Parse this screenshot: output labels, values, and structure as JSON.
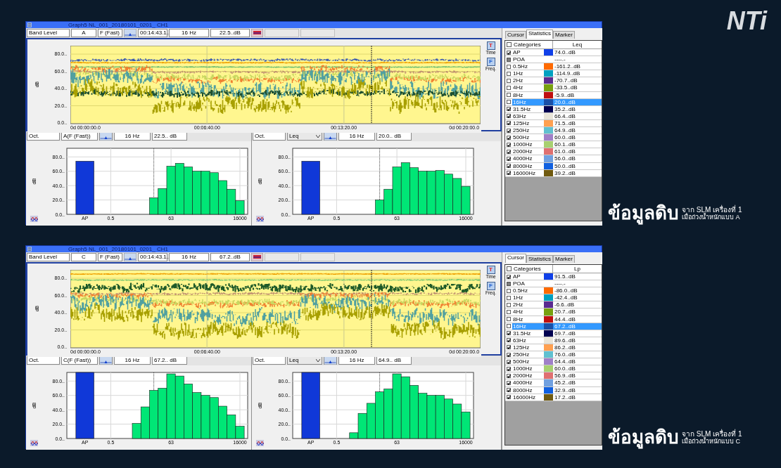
{
  "logo": "NTi",
  "panels": [
    {
      "title": "Graph5 NL_001_20180101_0201_ CH1",
      "toolbar": {
        "band_mode": "Band Level",
        "weighting": "A",
        "time_weighting": "F (Fast)",
        "time": "00:14:43.1..",
        "frequency": "16 Hz",
        "level": "22.5..dB"
      },
      "time_chart": {
        "ylabel": "dB",
        "y_tick_labels": [
          "80.0..",
          "60.0..",
          "40.0..",
          "20.0..",
          "0.0.."
        ],
        "x_tick_labels": [
          "0d 00:00:00.0",
          "00:06:40.00",
          "00:13:20.00",
          "0d 00:20:00.0"
        ]
      },
      "view_buttons": [
        {
          "letter": "T",
          "label": "Time",
          "color": "#e02020"
        },
        {
          "letter": "F",
          "label": "Freq.",
          "color": "#2060d0"
        }
      ],
      "spectra": [
        {
          "band": "Oct.",
          "mode": "A(F (Fast))",
          "kind": "field",
          "frequency": "16 Hz",
          "level": "22.5.. dB",
          "chart_data": {
            "type": "bar",
            "ylabel": "dB",
            "categories": [
              "AP",
              null,
              null,
              "0.5",
              null,
              null,
              null,
              null,
              null,
              null,
              "63",
              null,
              null,
              null,
              null,
              null,
              null,
              null,
              "16000"
            ],
            "series": [
              {
                "color": "#1038d8",
                "values": [
                  74,
                  null,
                  null,
                  null,
                  null,
                  null,
                  null,
                  null,
                  null,
                  null,
                  null,
                  null,
                  null,
                  null,
                  null,
                  null,
                  null,
                  null,
                  null
                ]
              },
              {
                "color": "#00e676",
                "values": [
                  null,
                  null,
                  null,
                  null,
                  null,
                  null,
                  null,
                  null,
                  23,
                  36,
                  67,
                  71,
                  66,
                  60,
                  60,
                  58,
                  47,
                  35,
                  19
                ]
              }
            ],
            "ylim": [
              0,
              92
            ],
            "yticks": [
              {
                "value": 0,
                "label": "0.0.."
              },
              {
                "value": 20,
                "label": "20.0.."
              },
              {
                "value": 40,
                "label": "40.0.."
              },
              {
                "value": 60,
                "label": "60.0.."
              },
              {
                "value": 80,
                "label": "80.0.."
              }
            ],
            "grid": true
          }
        },
        {
          "band": "Oct.",
          "mode": "Leq",
          "kind": "dropdown",
          "frequency": "16 Hz",
          "level": "20.0.. dB",
          "chart_data": {
            "type": "bar",
            "ylabel": "dB",
            "categories": [
              "AP",
              null,
              null,
              "0.5",
              null,
              null,
              null,
              null,
              null,
              null,
              "63",
              null,
              null,
              null,
              null,
              null,
              null,
              null,
              "16000"
            ],
            "series": [
              {
                "color": "#1038d8",
                "values": [
                  74,
                  null,
                  null,
                  null,
                  null,
                  null,
                  null,
                  null,
                  null,
                  null,
                  null,
                  null,
                  null,
                  null,
                  null,
                  null,
                  null,
                  null,
                  null
                ]
              },
              {
                "color": "#00e676",
                "values": [
                  null,
                  null,
                  null,
                  null,
                  null,
                  null,
                  null,
                  null,
                  20,
                  35,
                  66,
                  72,
                  65,
                  60,
                  60,
                  61,
                  56,
                  50,
                  39
                ]
              }
            ],
            "ylim": [
              0,
              92
            ],
            "yticks": [
              {
                "value": 0,
                "label": "0.0.."
              },
              {
                "value": 20,
                "label": "20.0.."
              },
              {
                "value": 40,
                "label": "40.0.."
              },
              {
                "value": 60,
                "label": "60.0.."
              },
              {
                "value": 80,
                "label": "80.0.."
              }
            ],
            "grid": true
          }
        }
      ],
      "stats": {
        "tabs": [
          {
            "label": "Cursor",
            "selected": false
          },
          {
            "label": "Statistics",
            "selected": true
          },
          {
            "label": "Marker",
            "selected": false
          }
        ],
        "all_checked": false,
        "columns": [
          "Categories",
          "Leq"
        ],
        "rows": [
          {
            "name": "AP",
            "checked": true,
            "disabled": false,
            "color": "#1040e8",
            "value": "74.0..dB",
            "selected": false
          },
          {
            "name": "POA",
            "checked": false,
            "disabled": true,
            "value": "----.-",
            "selected": false
          },
          {
            "name": "0.5Hz",
            "checked": false,
            "disabled": false,
            "color": "#ff6a00",
            "value": "-161.2..dB",
            "selected": false
          },
          {
            "name": "1Hz",
            "checked": false,
            "disabled": false,
            "color": "#00a0c0",
            "value": "-114.9..dB",
            "selected": false
          },
          {
            "name": "2Hz",
            "checked": false,
            "disabled": false,
            "color": "#5a2a90",
            "value": "-70.7..dB",
            "selected": false
          },
          {
            "name": "4Hz",
            "checked": false,
            "disabled": false,
            "color": "#78a010",
            "value": "-33.5..dB",
            "selected": false
          },
          {
            "name": "8Hz",
            "checked": false,
            "disabled": false,
            "color": "#c01010",
            "value": "-5.9..dB",
            "selected": false
          },
          {
            "name": "16Hz",
            "checked": false,
            "disabled": false,
            "color": "#1a50a8",
            "value": "20.0..dB",
            "selected": true
          },
          {
            "name": "31.5Hz",
            "checked": true,
            "disabled": false,
            "color": "#000050",
            "value": "35.2..dB",
            "selected": false
          },
          {
            "name": "63Hz",
            "checked": true,
            "disabled": false,
            "color": "#e8e4d8",
            "value": "66.4..dB",
            "selected": false
          },
          {
            "name": "125Hz",
            "checked": true,
            "disabled": false,
            "color": "#ffa050",
            "value": "71.5..dB",
            "selected": false
          },
          {
            "name": "250Hz",
            "checked": true,
            "disabled": false,
            "color": "#60c0d0",
            "value": "64.9..dB",
            "selected": false
          },
          {
            "name": "500Hz",
            "checked": true,
            "disabled": false,
            "color": "#a080c8",
            "value": "60.0..dB",
            "selected": false
          },
          {
            "name": "1000Hz",
            "checked": true,
            "disabled": false,
            "color": "#a8d070",
            "value": "60.1..dB",
            "selected": false
          },
          {
            "name": "2000Hz",
            "checked": true,
            "disabled": false,
            "color": "#e07070",
            "value": "61.0..dB",
            "selected": false
          },
          {
            "name": "4000Hz",
            "checked": true,
            "disabled": false,
            "color": "#70a0e0",
            "value": "56.0..dB",
            "selected": false
          },
          {
            "name": "8000Hz",
            "checked": true,
            "disabled": false,
            "color": "#1060e0",
            "value": "50.0..dB",
            "selected": false
          },
          {
            "name": "16000Hz",
            "checked": true,
            "disabled": false,
            "color": "#705a10",
            "value": "39.2..dB",
            "selected": false
          }
        ]
      },
      "caption": {
        "title": "ข้อมูลดิบ",
        "line_1": "จาก SLM เครื่องที่ 1",
        "line_2": "เมื่อถ่วงน้ำหนักแบบ A"
      }
    },
    {
      "title": "Graph5 NL_001_20180101_0201_ CH1",
      "toolbar": {
        "band_mode": "Band Level",
        "weighting": "C",
        "time_weighting": "F (Fast)",
        "time": "00:14:43.1..",
        "frequency": "16 Hz",
        "level": "67.2..dB"
      },
      "time_chart": {
        "ylabel": "dB",
        "y_tick_labels": [
          "80.0..",
          "60.0..",
          "40.0..",
          "20.0..",
          "0.0.."
        ],
        "x_tick_labels": [
          "0d 00:00:00.0",
          "00:06:40.00",
          "00:13:20.00",
          "0d 00:20:00.0"
        ]
      },
      "view_buttons": [
        {
          "letter": "T",
          "label": "Time",
          "color": "#e02020"
        },
        {
          "letter": "F",
          "label": "Freq.",
          "color": "#2060d0"
        }
      ],
      "spectra": [
        {
          "band": "Oct.",
          "mode": "C(F (Fast))",
          "kind": "field",
          "frequency": "16 Hz",
          "level": "67.2.. dB",
          "chart_data": {
            "type": "bar",
            "ylabel": "dB",
            "categories": [
              "AP",
              null,
              null,
              "0.5",
              null,
              null,
              null,
              null,
              null,
              null,
              "63",
              null,
              null,
              null,
              null,
              null,
              null,
              null,
              "16000"
            ],
            "series": [
              {
                "color": "#1038d8",
                "values": [
                  92,
                  null,
                  null,
                  null,
                  null,
                  null,
                  null,
                  null,
                  null,
                  null,
                  null,
                  null,
                  null,
                  null,
                  null,
                  null,
                  null,
                  null,
                  null
                ]
              },
              {
                "color": "#00e676",
                "values": [
                  null,
                  null,
                  null,
                  null,
                  null,
                  null,
                  21,
                  44,
                  67,
                  70,
                  90,
                  87,
                  76,
                  64,
                  60,
                  57,
                  45,
                  33,
                  17
                ]
              }
            ],
            "ylim": [
              0,
              92
            ],
            "yticks": [
              {
                "value": 0,
                "label": "0.0.."
              },
              {
                "value": 20,
                "label": "20.0.."
              },
              {
                "value": 40,
                "label": "40.0.."
              },
              {
                "value": 60,
                "label": "60.0.."
              },
              {
                "value": 80,
                "label": "80.0.."
              }
            ],
            "grid": true
          }
        },
        {
          "band": "Oct.",
          "mode": "Leq",
          "kind": "dropdown",
          "frequency": "16 Hz",
          "level": "64.9.. dB",
          "chart_data": {
            "type": "bar",
            "ylabel": "dB",
            "categories": [
              "AP",
              null,
              null,
              "0.5",
              null,
              null,
              null,
              null,
              null,
              null,
              "63",
              null,
              null,
              null,
              null,
              null,
              null,
              null,
              "16000"
            ],
            "series": [
              {
                "color": "#1038d8",
                "values": [
                  92,
                  null,
                  null,
                  null,
                  null,
                  null,
                  null,
                  null,
                  null,
                  null,
                  null,
                  null,
                  null,
                  null,
                  null,
                  null,
                  null,
                  null,
                  null
                ]
              },
              {
                "color": "#00e676",
                "values": [
                  null,
                  null,
                  null,
                  null,
                  null,
                  8,
                  35,
                  49,
                  65,
                  69,
                  90,
                  86,
                  74,
                  63,
                  60,
                  60,
                  55,
                  48,
                  37
                ]
              }
            ],
            "ylim": [
              0,
              92
            ],
            "yticks": [
              {
                "value": 0,
                "label": "0.0.."
              },
              {
                "value": 20,
                "label": "20.0.."
              },
              {
                "value": 40,
                "label": "40.0.."
              },
              {
                "value": 60,
                "label": "60.0.."
              },
              {
                "value": 80,
                "label": "80.0.."
              }
            ],
            "grid": true
          }
        }
      ],
      "stats": {
        "tabs": [
          {
            "label": "Cursor",
            "selected": true
          },
          {
            "label": "Statistics",
            "selected": false
          },
          {
            "label": "Marker",
            "selected": false
          }
        ],
        "all_checked": false,
        "columns": [
          "Categories",
          "Lp"
        ],
        "rows": [
          {
            "name": "AP",
            "checked": true,
            "disabled": false,
            "color": "#1040e8",
            "value": "91.5..dB",
            "selected": false
          },
          {
            "name": "POA",
            "checked": false,
            "disabled": true,
            "value": "----.-",
            "selected": false
          },
          {
            "name": "0.5Hz",
            "checked": false,
            "disabled": false,
            "color": "#ff6a00",
            "value": "-86.0..dB",
            "selected": false
          },
          {
            "name": "1Hz",
            "checked": false,
            "disabled": false,
            "color": "#00a0c0",
            "value": "-42.4..dB",
            "selected": false
          },
          {
            "name": "2Hz",
            "checked": false,
            "disabled": false,
            "color": "#5a2a90",
            "value": "-6.6..dB",
            "selected": false
          },
          {
            "name": "4Hz",
            "checked": false,
            "disabled": false,
            "color": "#78a010",
            "value": "20.7..dB",
            "selected": false
          },
          {
            "name": "8Hz",
            "checked": false,
            "disabled": false,
            "color": "#c01010",
            "value": "44.4..dB",
            "selected": false
          },
          {
            "name": "16Hz",
            "checked": false,
            "disabled": false,
            "color": "#1a50a8",
            "value": "67.2..dB",
            "selected": true
          },
          {
            "name": "31.5Hz",
            "checked": true,
            "disabled": false,
            "color": "#000050",
            "value": "69.7..dB",
            "selected": false
          },
          {
            "name": "63Hz",
            "checked": true,
            "disabled": false,
            "color": "#e8e4d8",
            "value": "89.6..dB",
            "selected": false
          },
          {
            "name": "125Hz",
            "checked": true,
            "disabled": false,
            "color": "#ffa050",
            "value": "86.2..dB",
            "selected": false
          },
          {
            "name": "250Hz",
            "checked": true,
            "disabled": false,
            "color": "#60c0d0",
            "value": "76.0..dB",
            "selected": false
          },
          {
            "name": "500Hz",
            "checked": true,
            "disabled": false,
            "color": "#a080c8",
            "value": "64.4..dB",
            "selected": false
          },
          {
            "name": "1000Hz",
            "checked": true,
            "disabled": false,
            "color": "#a8d070",
            "value": "60.0..dB",
            "selected": false
          },
          {
            "name": "2000Hz",
            "checked": true,
            "disabled": false,
            "color": "#e07070",
            "value": "56.9..dB",
            "selected": false
          },
          {
            "name": "4000Hz",
            "checked": true,
            "disabled": false,
            "color": "#70a0e0",
            "value": "45.2..dB",
            "selected": false
          },
          {
            "name": "8000Hz",
            "checked": true,
            "disabled": false,
            "color": "#1060e0",
            "value": "32.9..dB",
            "selected": false
          },
          {
            "name": "16000Hz",
            "checked": true,
            "disabled": false,
            "color": "#705a10",
            "value": "17.2..dB",
            "selected": false
          }
        ]
      },
      "caption": {
        "title": "ข้อมูลดิบ",
        "line_1": "จาก SLM เครื่องที่ 1",
        "line_2": "เมื่อถ่วงน้ำหนักแบบ C"
      }
    }
  ]
}
